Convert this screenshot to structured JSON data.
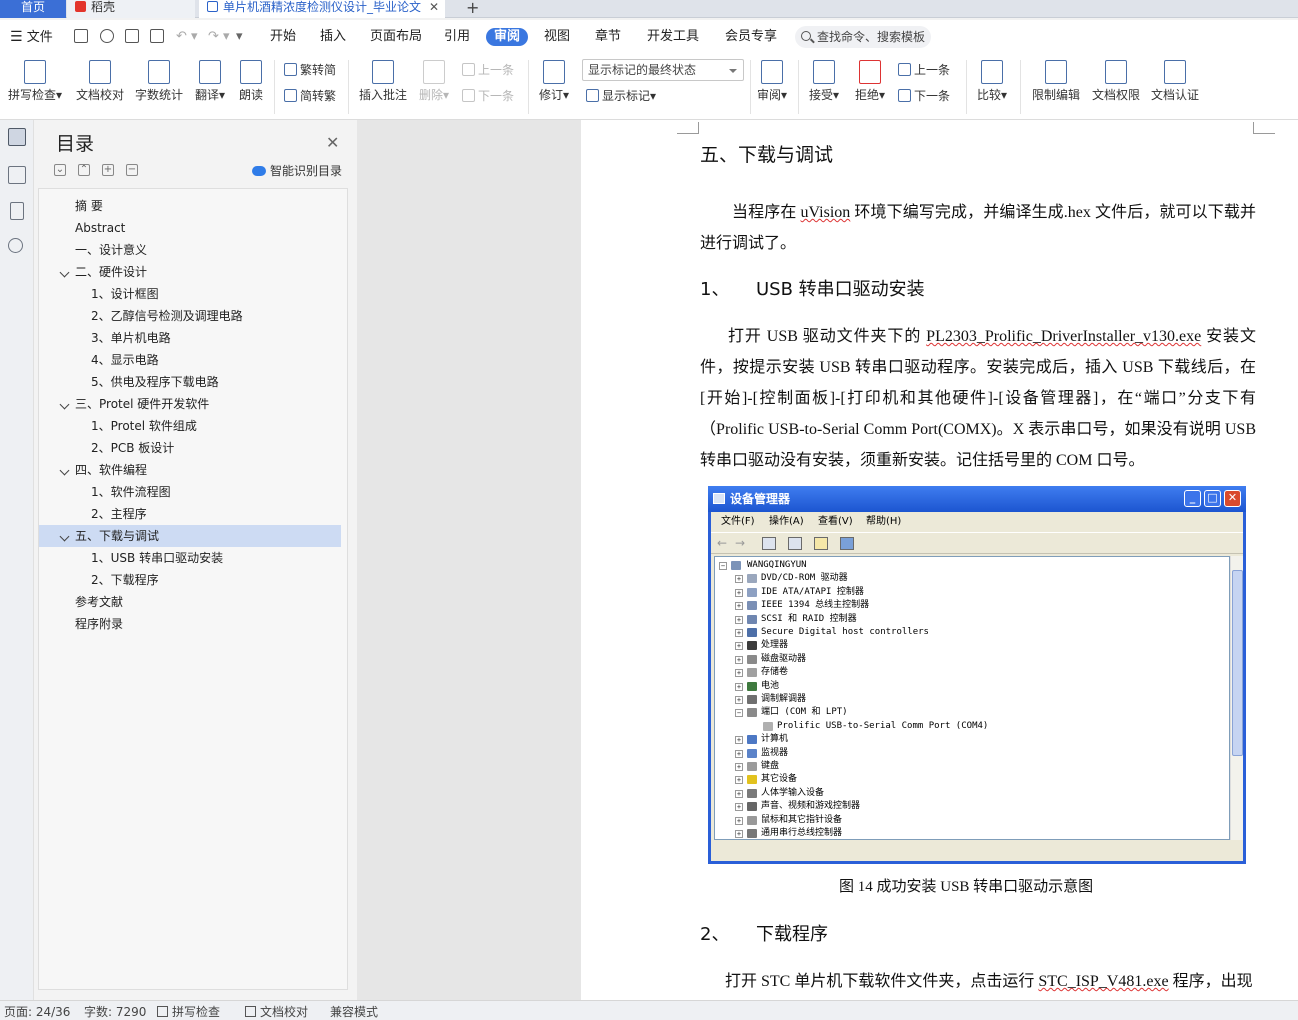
{
  "tabs": {
    "home": "首页",
    "daoke": "稻壳",
    "doc": "单片机酒精浓度检测仪设计_毕业论文",
    "add": "+"
  },
  "menu": {
    "file": "文件",
    "items": [
      "开始",
      "插入",
      "页面布局",
      "引用",
      "审阅",
      "视图",
      "章节",
      "开发工具",
      "会员专享"
    ],
    "search": "查找命令、搜索模板"
  },
  "ribbon": {
    "spell": "拼写检查",
    "doccheck": "文档校对",
    "wordcount": "字数统计",
    "translate": "翻译",
    "read": "朗读",
    "trad2simp": "繁转简",
    "simp2trad": "简转繁",
    "insert_comment": "插入批注",
    "delete": "删除",
    "prev_comment": "上一条",
    "next_comment": "下一条",
    "track": "修订",
    "markup_mode": "显示标记的最终状态",
    "show_markup": "显示标记",
    "review": "审阅",
    "accept": "接受",
    "reject": "拒绝",
    "prev_change": "上一条",
    "next_change": "下一条",
    "compare": "比较",
    "restrict": "限制编辑",
    "permission": "文档权限",
    "certify": "文档认证"
  },
  "toc": {
    "title": "目录",
    "smart": "智能识别目录",
    "items": [
      {
        "label": "摘  要"
      },
      {
        "label": "Abstract"
      },
      {
        "label": "一、设计意义"
      },
      {
        "label": "二、硬件设计"
      },
      {
        "label": "1、设计框图"
      },
      {
        "label": "2、乙醇信号检测及调理电路"
      },
      {
        "label": "3、单片机电路"
      },
      {
        "label": "4、显示电路"
      },
      {
        "label": "5、供电及程序下载电路"
      },
      {
        "label": "三、Protel 硬件开发软件"
      },
      {
        "label": "1、Protel 软件组成"
      },
      {
        "label": "2、PCB 板设计"
      },
      {
        "label": "四、软件编程"
      },
      {
        "label": "1、软件流程图"
      },
      {
        "label": "2、主程序"
      },
      {
        "label": "五、下载与调试"
      },
      {
        "label": "1、USB 转串口驱动安装"
      },
      {
        "label": "2、下载程序"
      },
      {
        "label": "参考文献"
      },
      {
        "label": "程序附录"
      }
    ]
  },
  "document": {
    "heading1": "五、下载与调试",
    "para1_a": "当程序在 ",
    "para1_b": "uVision",
    "para1_c": " 环境下编写完成，并编译生成.hex 文件后，就可以下载并进行调试了。",
    "h2_1_num": "1、",
    "h2_1_text": "USB 转串口驱动安装",
    "para2_a": "打开 USB 驱动文件夹下的 ",
    "para2_b": "PL2303_Prolific_DriverInstaller_v130.exe",
    "para2_c": " 安装文件，按提示安装 USB 转串口驱动程序。安装完成后，插入 USB 下载线后，在[开始]-[控制面板]-[打印机和其他硬件]-[设备管理器]，在“端口”分支下有（Prolific USB-to-Serial Comm Port(COMX)。X 表示串口号，如果没有说明 USB 转串口驱动没有安装，须重新安装。记住括号里的 COM 口号。",
    "caption": "图 14  成功安装 USB 转串口驱动示意图",
    "h2_2_num": "2、",
    "h2_2_text": "下载程序",
    "para3_a": "打开 STC 单片机下载软件文件夹，点击运行 ",
    "para3_b": "STC_ISP_V481.exe",
    "para3_c": " 程序，出现"
  },
  "devmgr": {
    "title": "设备管理器",
    "menu": [
      "文件(F)",
      "操作(A)",
      "查看(V)",
      "帮助(H)"
    ],
    "root": "WANGQINGYUN",
    "nodes": [
      "DVD/CD-ROM 驱动器",
      "IDE ATA/ATAPI 控制器",
      "IEEE 1394 总线主控制器",
      "SCSI 和 RAID 控制器",
      "Secure Digital host controllers",
      "处理器",
      "磁盘驱动器",
      "存储卷",
      "电池",
      "调制解调器",
      "端口 (COM 和 LPT)",
      "Prolific USB-to-Serial Comm Port (COM4)",
      "计算机",
      "监视器",
      "键盘",
      "其它设备",
      "人体学输入设备",
      "声音、视频和游戏控制器",
      "鼠标和其它指针设备",
      "通用串行总线控制器"
    ]
  },
  "status": {
    "page": "页面: 24/36",
    "words": "字数: 7290",
    "spell": "拼写检查",
    "doccheck": "文档校对",
    "compat": "兼容模式"
  },
  "colors": {
    "accent": "#3a77e0",
    "toc_selected": "#cddbf3",
    "xp_title": "#1c55d0"
  }
}
